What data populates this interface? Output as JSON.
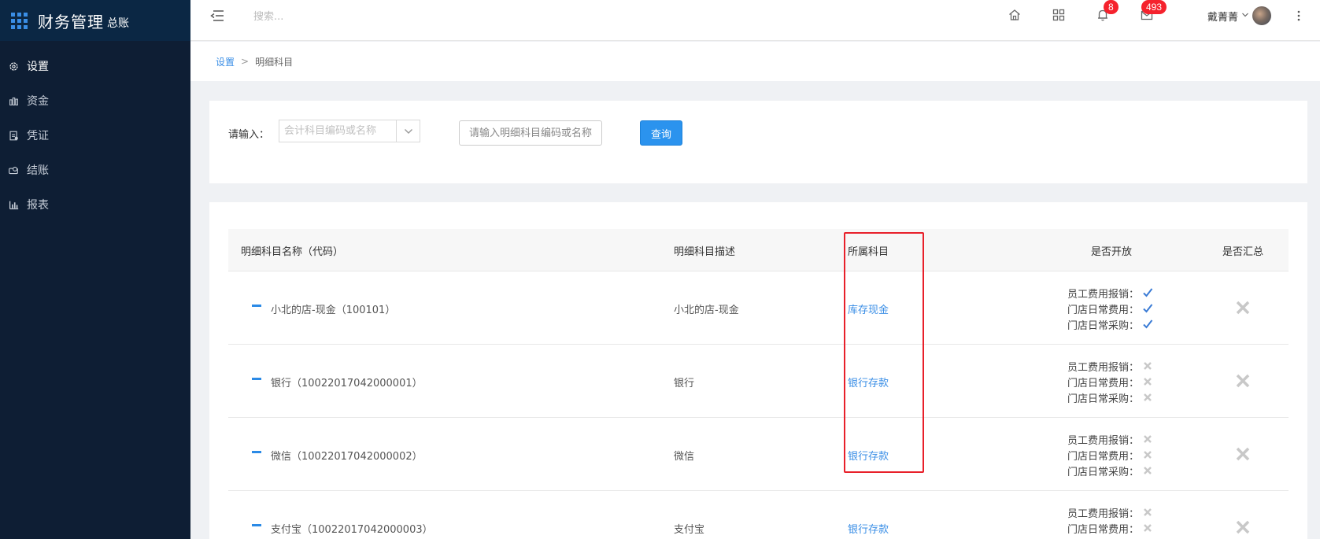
{
  "app": {
    "title": "财务管理",
    "subtitle": "总账"
  },
  "sidebar": {
    "items": [
      {
        "label": "设置",
        "icon": "gear-icon",
        "active": true
      },
      {
        "label": "资金",
        "icon": "fund-icon",
        "active": false
      },
      {
        "label": "凭证",
        "icon": "voucher-icon",
        "active": false
      },
      {
        "label": "结账",
        "icon": "checkout-icon",
        "active": false
      },
      {
        "label": "报表",
        "icon": "bar-chart-icon",
        "active": false
      }
    ]
  },
  "topbar": {
    "search_placeholder": "搜索...",
    "notifications_count": "8",
    "messages_count": "493",
    "user_name": "戴菁菁"
  },
  "breadcrumb": {
    "parent": "设置",
    "separator": ">",
    "current": "明细科目"
  },
  "search_panel": {
    "label": "请输入：",
    "account_placeholder": "会计科目编码或名称",
    "detail_placeholder": "请输入明细科目编码或名称",
    "query_button": "查询"
  },
  "table": {
    "headers": {
      "name": "明细科目名称（代码）",
      "desc": "明细科目描述",
      "account": "所属科目",
      "open": "是否开放",
      "summary": "是否汇总"
    },
    "rows": [
      {
        "name": "小北的店-现金（100101）",
        "desc": "小北的店-现金",
        "account": "库存现金",
        "open": [
          {
            "label": "员工费用报销：",
            "checked": true
          },
          {
            "label": "门店日常费用：",
            "checked": true
          },
          {
            "label": "门店日常采购：",
            "checked": true
          }
        ],
        "summary": false
      },
      {
        "name": "银行（10022017042000001）",
        "desc": "银行",
        "account": "银行存款",
        "open": [
          {
            "label": "员工费用报销：",
            "checked": false
          },
          {
            "label": "门店日常费用：",
            "checked": false
          },
          {
            "label": "门店日常采购：",
            "checked": false
          }
        ],
        "summary": false
      },
      {
        "name": "微信（10022017042000002）",
        "desc": "微信",
        "account": "银行存款",
        "open": [
          {
            "label": "员工费用报销：",
            "checked": false
          },
          {
            "label": "门店日常费用：",
            "checked": false
          },
          {
            "label": "门店日常采购：",
            "checked": false
          }
        ],
        "summary": false
      },
      {
        "name": "支付宝（10022017042000003）",
        "desc": "支付宝",
        "account": "银行存款",
        "open": [
          {
            "label": "员工费用报销：",
            "checked": false
          },
          {
            "label": "门店日常费用：",
            "checked": false
          }
        ],
        "summary": false
      }
    ]
  },
  "colors": {
    "accent": "#2b93ee",
    "sidebar_bg": "#0e1e34",
    "highlight": "#e8202a",
    "check": "#3a7bd5"
  }
}
